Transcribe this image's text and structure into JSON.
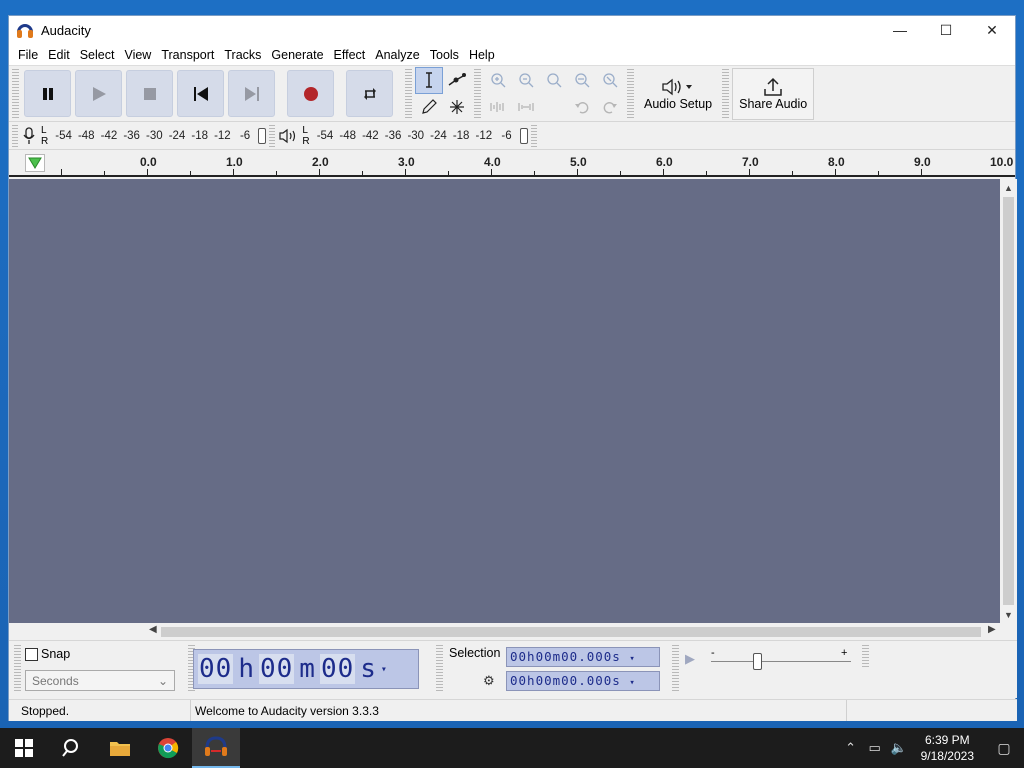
{
  "window": {
    "title": "Audacity",
    "controls": {
      "minimize": "—",
      "maximize": "☐",
      "close": "✕"
    }
  },
  "menu": [
    "File",
    "Edit",
    "Select",
    "View",
    "Transport",
    "Tracks",
    "Generate",
    "Effect",
    "Analyze",
    "Tools",
    "Help"
  ],
  "toolbar": {
    "audio_setup_label": "Audio Setup",
    "share_audio_label": "Share Audio"
  },
  "meters": {
    "record_scale": [
      "-54",
      "-48",
      "-42",
      "-36",
      "-30",
      "-24",
      "-18",
      "-12",
      "-6"
    ],
    "playback_scale": [
      "-54",
      "-48",
      "-42",
      "-36",
      "-30",
      "-24",
      "-18",
      "-12",
      "-6"
    ],
    "l": "L",
    "r": "R"
  },
  "ruler": {
    "labels": [
      "0.0",
      "1.0",
      "2.0",
      "3.0",
      "4.0",
      "5.0",
      "6.0",
      "7.0",
      "8.0",
      "9.0",
      "10.0"
    ]
  },
  "bottom": {
    "snap_label": "Snap",
    "snap_checked": false,
    "units": "Seconds",
    "time_hours": "00",
    "time_h": "h",
    "time_minutes": "00",
    "time_m": "m",
    "time_seconds": "00",
    "time_s": "s",
    "selection_label": "Selection",
    "selection_start": "00h00m00.000s",
    "selection_end": "00h00m00.000s",
    "play_speed_min": "-",
    "play_speed_max": "+"
  },
  "status": {
    "state": "Stopped.",
    "message": "Welcome to Audacity version 3.3.3"
  },
  "taskbar": {
    "time": "6:39 PM",
    "date": "9/18/2023"
  }
}
